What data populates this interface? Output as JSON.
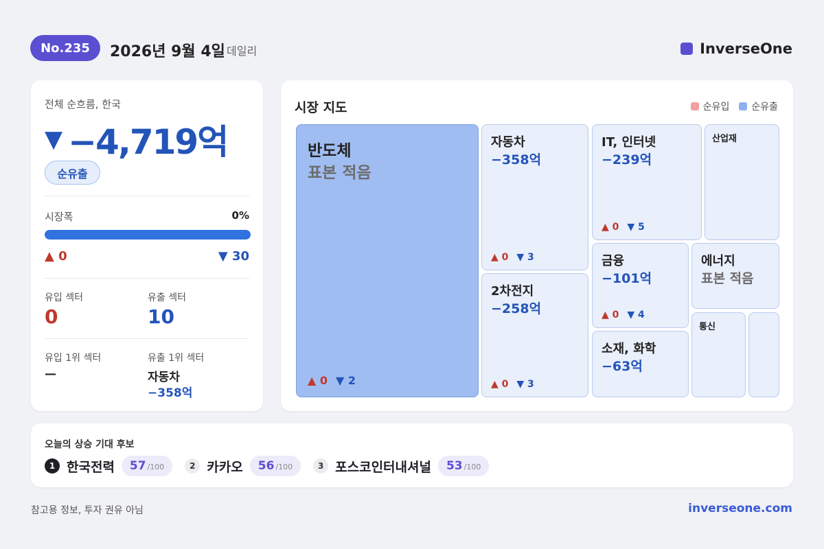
{
  "header": {
    "issue": "No.235",
    "date": "2026년 9월 4일",
    "type": "데일리",
    "brand": "InverseOne",
    "brand_color": "#5b4fd1"
  },
  "summary": {
    "label": "전체 순흐름, 한국",
    "arrow": "▼",
    "value": "−4,719억",
    "flow_label": "순유출",
    "breadth_label": "시장폭",
    "breadth_value": "0%",
    "breadth_fraction": 1.0,
    "up_count": "▲ 0",
    "down_count": "▼ 30",
    "inflow_sectors_label": "유입 섹터",
    "inflow_sectors": "0",
    "outflow_sectors_label": "유출 섹터",
    "outflow_sectors": "10",
    "top_inflow_label": "유입 1위 섹터",
    "top_inflow": "—",
    "top_outflow_label": "유출 1위 섹터",
    "top_outflow_name": "자동차",
    "top_outflow_value": "−358억"
  },
  "market_map": {
    "title": "시장 지도",
    "legend": [
      {
        "label": "순유입",
        "color": "#f0a0a0"
      },
      {
        "label": "순유출",
        "color": "#8fb0ee"
      }
    ],
    "tiles": {
      "semis": {
        "name": "반도체",
        "value": "표본 적음",
        "up": "▲ 0",
        "down": "▼ 2"
      },
      "auto": {
        "name": "자동차",
        "value": "−358억",
        "up": "▲ 0",
        "down": "▼ 3"
      },
      "battery": {
        "name": "2차전지",
        "value": "−258억",
        "up": "▲ 0",
        "down": "▼ 3"
      },
      "it": {
        "name": "IT, 인터넷",
        "value": "−239억",
        "up": "▲ 0",
        "down": "▼ 5"
      },
      "industrials": {
        "name": "산업재"
      },
      "finance": {
        "name": "금융",
        "value": "−101억",
        "up": "▲ 0",
        "down": "▼ 4"
      },
      "energy": {
        "name": "에너지",
        "value": "표본 적음"
      },
      "materials": {
        "name": "소재, 화학",
        "value": "−63억"
      },
      "telecom": {
        "name": "통신"
      },
      "other": {}
    }
  },
  "candidates": {
    "title": "오늘의 상승 기대 후보",
    "items": [
      {
        "rank": "1",
        "name": "한국전력",
        "score": "57",
        "max": "/100"
      },
      {
        "rank": "2",
        "name": "카카오",
        "score": "56",
        "max": "/100"
      },
      {
        "rank": "3",
        "name": "포스코인터내셔널",
        "score": "53",
        "max": "/100"
      }
    ]
  },
  "footer": {
    "disclaimer": "참고용 정보, 투자 권유 아님",
    "site": "inverseone.com"
  }
}
